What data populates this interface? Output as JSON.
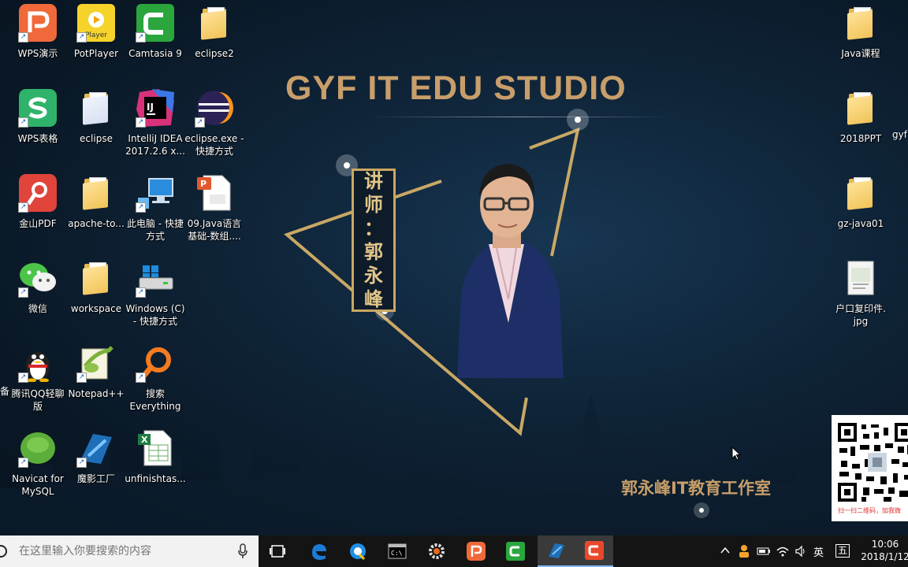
{
  "desktop": {
    "brand_title": "GYF IT EDU STUDIO",
    "studio_caption": "郭永峰IT教育工作室",
    "teacher_plaque": [
      "讲",
      "师",
      "：",
      "郭",
      "永",
      "峰"
    ],
    "qr_caption": "扫一扫二维码，加我微",
    "icons": {
      "wps_present": "WPS演示",
      "potplayer": "PotPlayer",
      "camtasia": "Camtasia 9",
      "eclipse2": "eclipse2",
      "wps_sheet": "WPS表格",
      "eclipse": "eclipse",
      "intellij": "IntelliJ IDEA\n2017.2.6 x...",
      "eclipse_exe": "eclipse.exe -\n快捷方式",
      "jinshan_pdf": "金山PDF",
      "apache": "apache-to...",
      "this_pc": "此电脑 - 快捷\n方式",
      "java_array": "09.Java语言\n基础-数组....",
      "wechat": "微信",
      "workspace": "workspace",
      "windows_c": "Windows (C)\n- 快捷方式",
      "qq": "腾讯QQ轻聊\n版",
      "qq_left": "备",
      "notepadpp": "Notepad++",
      "everything": "搜索\nEverything",
      "navicat": "Navicat for\nMySQL",
      "moying": "魔影工厂",
      "unfinished": "unfinishtas...",
      "java_course": "Java课程",
      "ppt2018": "2018PPT",
      "gyf_cut": "gyf",
      "gz_java": "gz-java01",
      "hukou": "户口复印件.\njpg"
    }
  },
  "taskbar": {
    "search_placeholder": "在这里输入你要搜索的内容",
    "ime_lang": "英",
    "ime_mode": "五",
    "clock_time": "10:06",
    "clock_date": "2018/1/12"
  }
}
